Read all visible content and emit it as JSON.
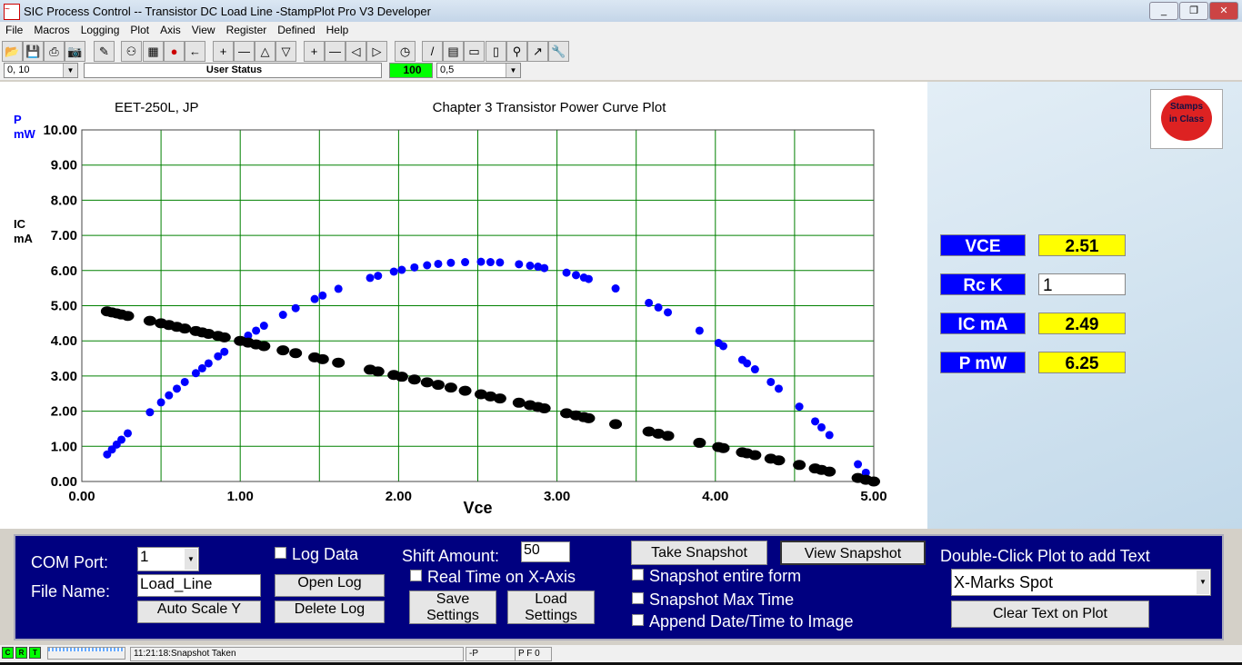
{
  "window": {
    "title": "SIC Process Control -- Transistor DC Load Line -StampPlot Pro V3 Developer",
    "min": "_",
    "max": "❐",
    "close": "✕"
  },
  "menu": [
    "File",
    "Macros",
    "Logging",
    "Plot",
    "Axis",
    "View",
    "Register",
    "Defined",
    "Help"
  ],
  "toolbar": {
    "icons": [
      "open-folder",
      "save",
      "print",
      "camera",
      "wand",
      "connect",
      "scope",
      "stop",
      "back-arrow",
      "plus",
      "minus",
      "up",
      "down",
      "plus",
      "minus",
      "left",
      "right",
      "clock",
      "pen",
      "image",
      "note",
      "film",
      "probe",
      "pick",
      "wrench"
    ]
  },
  "row2": {
    "y_range": "0, 10",
    "user_status": "User Status",
    "level": "100",
    "x_range": "0,5"
  },
  "plot": {
    "label_left": "EET-250L, JP",
    "title": "Chapter 3 Transistor Power Curve Plot",
    "y_label_p": [
      "P",
      "mW"
    ],
    "y_label_ic": [
      "IC",
      "mA"
    ],
    "p_color": "#0000ff",
    "ic_color": "#000000",
    "grid_color": "#008000"
  },
  "chart_data": {
    "type": "scatter",
    "title": "Chapter 3 Transistor Power Curve Plot",
    "xlabel": "Vce",
    "xlim": [
      0,
      5
    ],
    "ylim": [
      0,
      10
    ],
    "grid": true,
    "xticks": [
      "0.00",
      "1.00",
      "2.00",
      "3.00",
      "4.00",
      "5.00"
    ],
    "yticks": [
      "0.00",
      "1.00",
      "2.00",
      "3.00",
      "4.00",
      "5.00",
      "6.00",
      "7.00",
      "8.00",
      "9.00",
      "10.00"
    ],
    "x": [
      0.16,
      0.19,
      0.22,
      0.25,
      0.29,
      0.43,
      0.5,
      0.55,
      0.6,
      0.65,
      0.72,
      0.76,
      0.8,
      0.86,
      0.9,
      1.0,
      1.05,
      1.1,
      1.15,
      1.27,
      1.35,
      1.47,
      1.52,
      1.62,
      1.82,
      1.87,
      1.97,
      2.02,
      2.1,
      2.18,
      2.25,
      2.33,
      2.42,
      2.52,
      2.58,
      2.64,
      2.76,
      2.83,
      2.88,
      2.92,
      3.06,
      3.12,
      3.17,
      3.2,
      3.37,
      3.58,
      3.64,
      3.7,
      3.9,
      4.02,
      4.05,
      4.17,
      4.2,
      4.25,
      4.35,
      4.4,
      4.53,
      4.63,
      4.67,
      4.72,
      4.9,
      4.95,
      5.0
    ],
    "series": [
      {
        "name": "P mW",
        "color": "#0000ff",
        "values": [
          0.77,
          0.91,
          1.05,
          1.19,
          1.37,
          1.97,
          2.25,
          2.45,
          2.64,
          2.83,
          3.08,
          3.22,
          3.36,
          3.56,
          3.69,
          4.0,
          4.15,
          4.29,
          4.43,
          4.74,
          4.93,
          5.19,
          5.29,
          5.48,
          5.79,
          5.85,
          5.97,
          6.02,
          6.09,
          6.15,
          6.19,
          6.22,
          6.24,
          6.25,
          6.24,
          6.23,
          6.18,
          6.14,
          6.11,
          6.07,
          5.94,
          5.87,
          5.8,
          5.76,
          5.49,
          5.08,
          4.95,
          4.81,
          4.29,
          3.94,
          3.85,
          3.46,
          3.36,
          3.19,
          2.83,
          2.64,
          2.13,
          1.71,
          1.54,
          1.32,
          0.49,
          0.25,
          0
        ]
      },
      {
        "name": "IC mA",
        "color": "#000000",
        "values": [
          4.84,
          4.81,
          4.78,
          4.75,
          4.71,
          4.57,
          4.5,
          4.45,
          4.4,
          4.35,
          4.28,
          4.24,
          4.2,
          4.14,
          4.1,
          4.0,
          3.95,
          3.9,
          3.85,
          3.73,
          3.65,
          3.53,
          3.48,
          3.38,
          3.18,
          3.13,
          3.03,
          2.98,
          2.9,
          2.82,
          2.75,
          2.67,
          2.58,
          2.48,
          2.42,
          2.36,
          2.24,
          2.17,
          2.12,
          2.08,
          1.94,
          1.88,
          1.83,
          1.8,
          1.63,
          1.42,
          1.36,
          1.3,
          1.1,
          0.98,
          0.95,
          0.83,
          0.8,
          0.75,
          0.65,
          0.6,
          0.47,
          0.37,
          0.33,
          0.28,
          0.1,
          0.05,
          0
        ]
      }
    ]
  },
  "readouts": [
    {
      "label": "VCE",
      "value": "2.51"
    },
    {
      "label": "Rc K",
      "value": "1"
    },
    {
      "label": "IC mA",
      "value": "2.49"
    },
    {
      "label": "P mW",
      "value": "6.25"
    }
  ],
  "logo": "Stamps in Class",
  "controls": {
    "com_port_label": "COM Port:",
    "com_port": "1",
    "file_name_label": "File Name:",
    "file_name": "Load_Line",
    "auto_scale": "Auto Scale Y",
    "log_data": "Log Data",
    "open_log": "Open Log",
    "delete_log": "Delete Log",
    "shift_label": "Shift Amount:",
    "shift": "50",
    "real_time": "Real Time on X-Axis",
    "save_settings": "Save Settings",
    "load_settings": "Load Settings",
    "take_snapshot": "Take Snapshot",
    "view_snapshot": "View Snapshot",
    "snap_form": "Snapshot entire form",
    "snap_max": "Snapshot Max Time",
    "append_date": "Append Date/Time to Image",
    "dbl_click": "Double-Click Plot to add Text",
    "text_choice": "X-Marks Spot",
    "clear_text": "Clear Text on Plot"
  },
  "status": {
    "leds": [
      "C",
      "R",
      "T"
    ],
    "message": "11:21:18:Snapshot Taken",
    "p": "-P",
    "pf": "P F 0"
  }
}
